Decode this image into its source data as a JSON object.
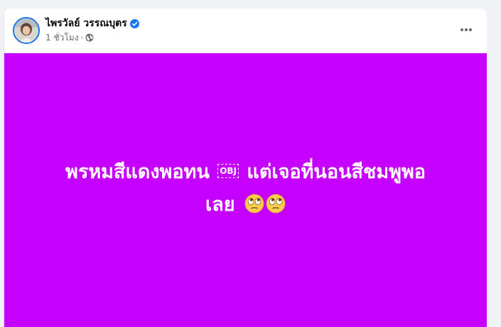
{
  "post": {
    "author": {
      "name": "ไพรวัลย์ วรรณบุตร",
      "verified": true,
      "avatar_icon": "profile-photo"
    },
    "meta": {
      "timestamp": "1 ชั่วโมง",
      "separator": "·",
      "audience_icon": "globe-icon"
    },
    "more_icon": "more-horizontal-icon",
    "background_color": "#c600ff",
    "text_line_1_a": "พรหมสีแดงพอทน",
    "placeholder_glyph": "OBJ",
    "text_line_1_b": "แต่เจอที่นอนสีชมพูพอ",
    "text_line_2": "เลย",
    "emoji_icons": [
      "face-with-rolling-eyes-icon",
      "face-with-rolling-eyes-icon"
    ]
  },
  "colors": {
    "page_background": "#f0f2f5",
    "card_background": "#ffffff",
    "verified_blue": "#1877f2",
    "text_primary": "#050505",
    "text_secondary": "#65676b"
  }
}
